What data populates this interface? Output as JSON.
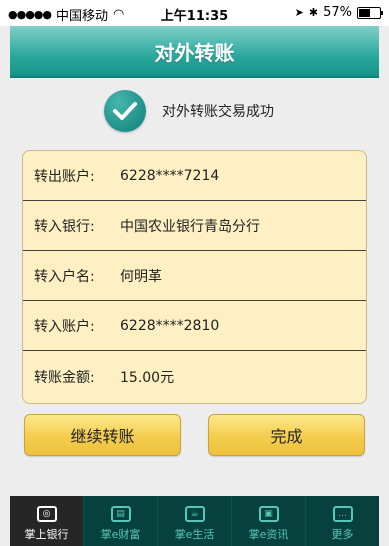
{
  "status_bar": {
    "signal": "●●●●●",
    "carrier": "中国移动",
    "wifi": "◠",
    "time": "上午11:35",
    "location": "➤",
    "bluetooth": "✱",
    "battery_percent": "57%",
    "battery_level": 0.57
  },
  "nav": {
    "title": "对外转账"
  },
  "result": {
    "message": "对外转账交易成功"
  },
  "details": [
    {
      "label": "转出账户:",
      "value": "6228****7214"
    },
    {
      "label": "转入银行:",
      "value": "中国农业银行青岛分行"
    },
    {
      "label": "转入户名:",
      "value": "何明革"
    },
    {
      "label": "转入账户:",
      "value": "6228****2810"
    },
    {
      "label": "转账金额:",
      "value": "15.00元"
    }
  ],
  "buttons": {
    "continue": "继续转账",
    "done": "完成"
  },
  "tabs": [
    {
      "label": "掌上银行",
      "icon": "bank-icon",
      "glyph": "◎"
    },
    {
      "label": "掌e财富",
      "icon": "wealth-icon",
      "glyph": "▤"
    },
    {
      "label": "掌e生活",
      "icon": "life-icon",
      "glyph": "☕"
    },
    {
      "label": "掌e资讯",
      "icon": "news-icon",
      "glyph": "▣"
    },
    {
      "label": "更多",
      "icon": "more-icon",
      "glyph": "…"
    }
  ],
  "colors": {
    "nav_teal": "#2ba89e",
    "card_bg": "#fef0c2",
    "button_yellow": "#f4cd4e",
    "tabbar_bg": "#07413d",
    "check_teal": "#0d8078"
  }
}
